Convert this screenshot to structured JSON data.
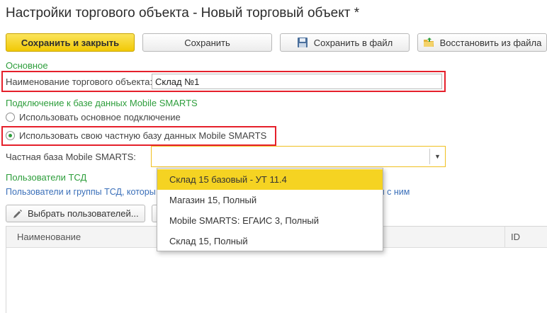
{
  "window": {
    "title": "Настройки торгового объекта - Новый торговый объект *"
  },
  "toolbar": {
    "save_close_label": "Сохранить и закрыть",
    "save_label": "Сохранить",
    "save_file_label": "Сохранить в файл",
    "restore_file_label": "Восстановить из файла"
  },
  "main_section": {
    "heading": "Основное",
    "name_label": "Наименование торгового объекта:",
    "name_value": "Склад №1"
  },
  "connection": {
    "heading": "Подключение к базе данных Mobile SMARTS",
    "radio_default_label": "Использовать основное подключение",
    "radio_private_label": "Использовать свою частную базу данных Mobile SMARTS",
    "selected": "private",
    "private_db_label": "Частная база Mobile SMARTS:",
    "private_db_value": ""
  },
  "users": {
    "heading": "Пользователи ТСД",
    "description_left": "Пользователи и группы ТСД, которы",
    "description_right": "ты с ним",
    "select_users_label": "Выбрать пользователей..."
  },
  "table": {
    "columns": [
      "Наименование",
      "ID"
    ]
  },
  "dropdown": {
    "options": [
      "Склад 15 базовый - УТ 11.4",
      "Магазин 15, Полный",
      "Mobile SMARTS: ЕГАИС 3, Полный",
      "Склад 15, Полный"
    ],
    "selected_index": 0
  },
  "colors": {
    "accent_yellow": "#f5d322",
    "section_green": "#2e9e3c",
    "highlight_red": "#e5202b",
    "link_blue": "#3a6fb9"
  }
}
